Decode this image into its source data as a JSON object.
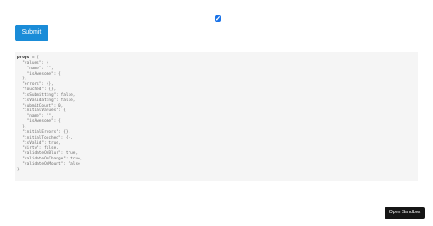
{
  "form": {
    "checkbox_checked": true,
    "submit_label": "Submit"
  },
  "props_panel": {
    "label": "props",
    "code": " = {\n  \"values\": {\n    \"name\": \"\",\n    \"isAwesome\": {\n  },\n  \"errors\": {},\n  \"touched\": {},\n  \"isSubmitting\": false,\n  \"isValidating\": false,\n  \"submitCount\": 0,\n  \"initialValues\": {\n    \"name\": \"\",\n    \"isAwesome\": {\n  },\n  \"initialErrors\": {},\n  \"initialTouched\": {},\n  \"isValid\": true,\n  \"dirty\": false,\n  \"validateOnBlur\": true,\n  \"validateOnChange\": true,\n  \"validateOnMount\": false\n}"
  },
  "footer": {
    "open_sandbox_label": "Open Sandbox"
  },
  "colors": {
    "submit_button": "#1a8cd8",
    "code_background": "#f5f5f5",
    "open_sandbox_background": "#151515"
  }
}
